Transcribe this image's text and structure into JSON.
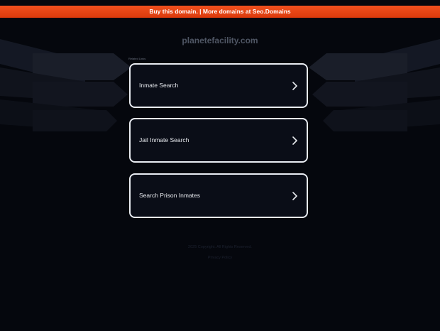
{
  "banner": {
    "text": "Buy this domain. | More domains at Seo.Domains"
  },
  "domain": "planetefacility.com",
  "related_label": "Related Links",
  "links": [
    {
      "label": "Inmate Search"
    },
    {
      "label": "Jail Inmate Search"
    },
    {
      "label": "Search Prison Inmates"
    }
  ],
  "footer": {
    "copyright": "2025 Copyright. All Rights Reserved.",
    "privacy": "Privacy Policy"
  },
  "colors": {
    "banner": "#e8461a",
    "background": "#05070d",
    "card_border": "#e9ecf2"
  }
}
